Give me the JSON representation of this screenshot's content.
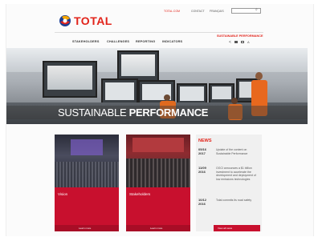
{
  "topbar": {
    "total_link": "TOTAL.COM",
    "contact": "CONTACT",
    "language": "FRANÇAIS",
    "search_placeholder": ""
  },
  "brand": {
    "name": "TOTAL"
  },
  "nav": {
    "items": [
      "STAKEHOLDERS",
      "CHALLENGES",
      "REPORTING",
      "INDICATORS"
    ]
  },
  "section_label": "SUSTAINABLE PERFORMANCE",
  "hero": {
    "title_light": "SUSTAINABLE ",
    "title_bold": "PERFORMANCE"
  },
  "cards": [
    {
      "label": "Vision",
      "button": "Learn more"
    },
    {
      "label": "Stakeholders",
      "button": "Learn more"
    }
  ],
  "news": {
    "heading": "NEWS",
    "items": [
      {
        "day": "05/16",
        "year": "2017",
        "text": "Update of the content on Sustainable Performance"
      },
      {
        "day": "11/09",
        "year": "2016",
        "text": "OGCI announces a $1 billion investment to accelerate the development and deployment of low emissions technologies"
      },
      {
        "day": "10/12",
        "year": "2016",
        "text": "Total commits its road safety"
      }
    ],
    "view_all": "View all news"
  },
  "colors": {
    "brand_red": "#e2231a",
    "card_red": "#c8102e",
    "news_bg": "#f0f0f0"
  },
  "icons": [
    "search-icon",
    "share-icon",
    "print-icon",
    "mail-icon",
    "font-size-icon"
  ]
}
